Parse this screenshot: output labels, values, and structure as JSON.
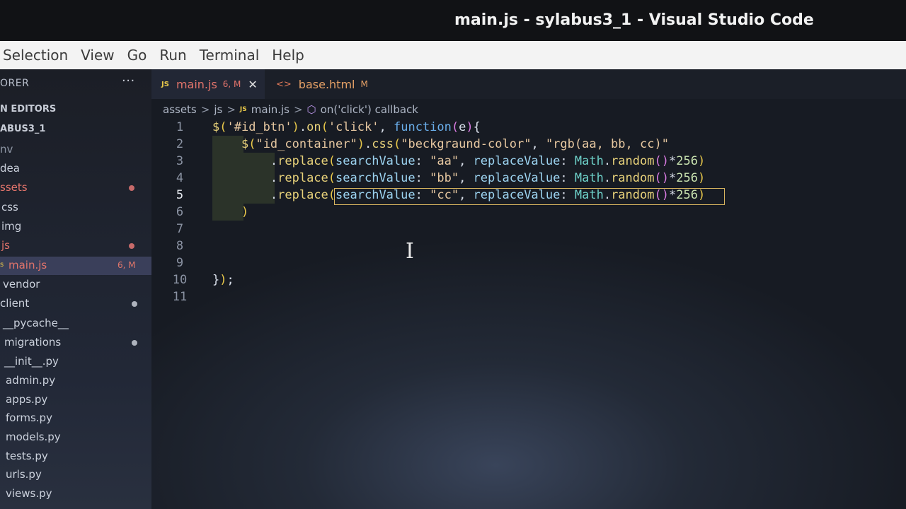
{
  "window": {
    "title": "main.js - sylabus3_1 - Visual Studio Code"
  },
  "menu": [
    "Selection",
    "View",
    "Go",
    "Run",
    "Terminal",
    "Help"
  ],
  "sidebar": {
    "header": "ORER",
    "more": "···",
    "open_editors": "N EDITORS",
    "project": "ABUS3_1",
    "items": [
      {
        "label": "nv"
      },
      {
        "label": "dea"
      },
      {
        "label": "ssets"
      },
      {
        "label": "css"
      },
      {
        "label": "img"
      },
      {
        "label": "js"
      },
      {
        "label": "main.js",
        "badge": "6, M"
      },
      {
        "label": "vendor"
      },
      {
        "label": "client"
      },
      {
        "label": "__pycache__"
      },
      {
        "label": "migrations"
      },
      {
        "label": "__init__.py"
      },
      {
        "label": "admin.py"
      },
      {
        "label": "apps.py"
      },
      {
        "label": "forms.py"
      },
      {
        "label": "models.py"
      },
      {
        "label": "tests.py"
      },
      {
        "label": "urls.py"
      },
      {
        "label": "views.py"
      }
    ]
  },
  "tabs": [
    {
      "icon": "JS",
      "label": "main.js",
      "meta": "6, M",
      "close": "✕"
    },
    {
      "icon": "<>",
      "label": "base.html",
      "meta": "M"
    }
  ],
  "breadcrumb": {
    "parts": [
      "assets",
      "js",
      "main.js",
      "on('click') callback"
    ],
    "js_icon": "JS",
    "separator": ">"
  },
  "editor": {
    "line_numbers": [
      "1",
      "2",
      "3",
      "4",
      "5",
      "6",
      "7",
      "8",
      "9",
      "10",
      "11"
    ],
    "lines": [
      "$('#id_btn').on('click', function(e){",
      "    $(\"id_container\").css(\"beckgraund-color\", \"rgb(aa, bb, cc)\"",
      "        .replace(searchValue: \"aa\", replaceValue: Math.random()*256)",
      "        .replace(searchValue: \"bb\", replaceValue: Math.random()*256)",
      "        .replace(searchValue: \"cc\", replaceValue: Math.random()*256)",
      "    )",
      "",
      "",
      "",
      "});",
      ""
    ],
    "current_line": 5
  }
}
